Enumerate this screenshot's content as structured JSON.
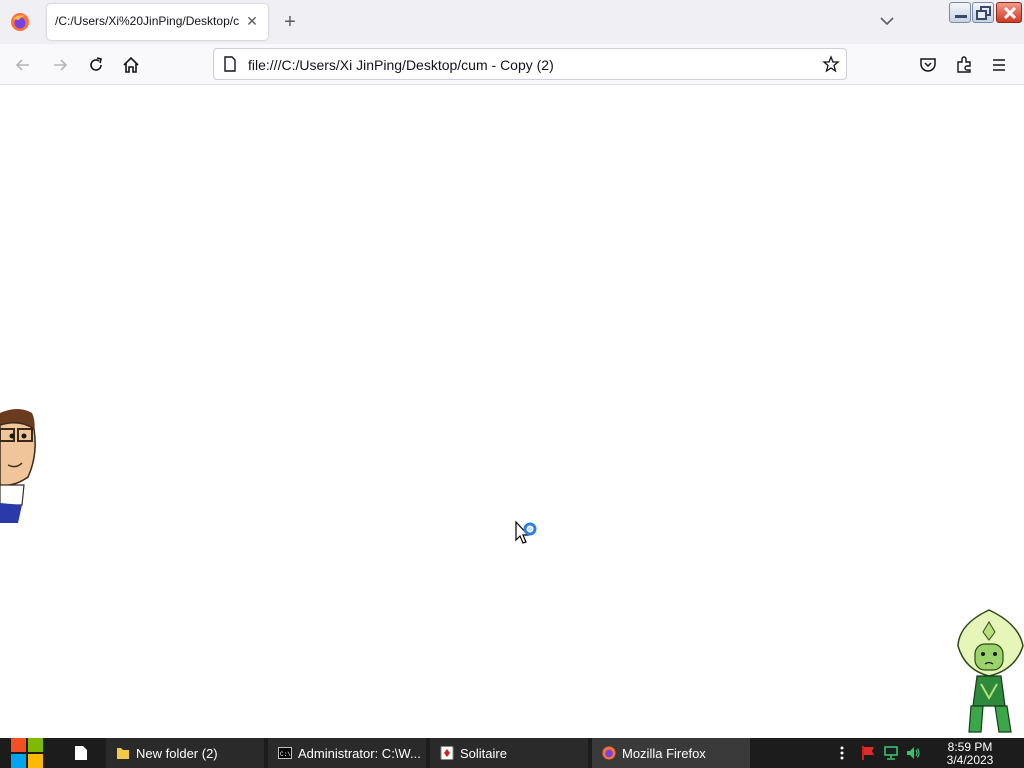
{
  "browser": {
    "tab": {
      "title": "/C:/Users/Xi%20JinPing/Desktop/c",
      "close_icon": "close-icon"
    },
    "new_tab_icon": "plus-icon",
    "url": "file:///C:/Users/Xi JinPing/Desktop/cum - Copy (2)"
  },
  "taskbar": {
    "tasks": [
      {
        "label": "New folder (2)",
        "icon": "folder-icon"
      },
      {
        "label": "Administrator: C:\\W...",
        "icon": "cmd-icon"
      },
      {
        "label": "Solitaire",
        "icon": "solitaire-icon"
      },
      {
        "label": "Mozilla Firefox",
        "icon": "firefox-icon",
        "active": true
      }
    ],
    "clock": {
      "time": "8:59 PM",
      "date": "3/4/2023"
    }
  },
  "colors": {
    "taskbar": "#1c1c1c",
    "tabstrip": "#f0f0f4",
    "toolbar": "#f9f9fb"
  }
}
